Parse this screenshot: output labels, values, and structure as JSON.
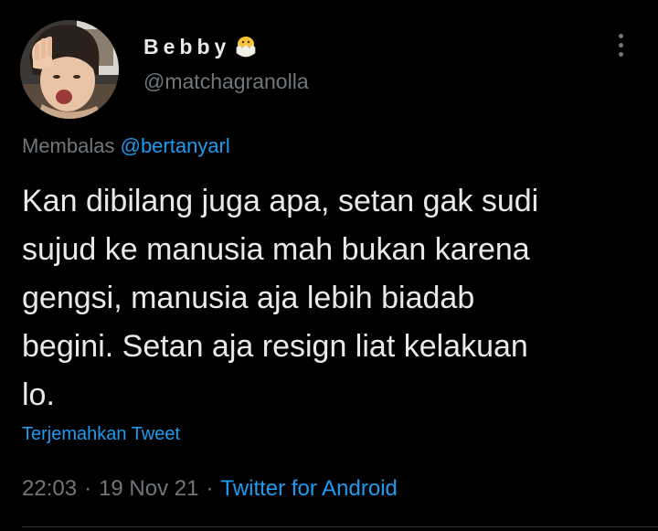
{
  "user": {
    "display_name": "Bebby",
    "name_emoji": "hatching-chick-emoji",
    "handle": "@matchagranolla"
  },
  "reply": {
    "prefix": "Membalas",
    "mention": "@bertanyarl"
  },
  "tweet": {
    "text": "Kan dibilang juga apa, setan gak sudi\nsujud ke manusia mah bukan karena\ngengsi, manusia aja lebih biadab\nbegini. Setan aja resign liat kelakuan\nlo.",
    "translate_label": "Terjemahkan Tweet",
    "time": "22:03",
    "date": "19 Nov 21",
    "source": "Twitter for Android",
    "separator": "·"
  },
  "icons": {
    "more": "more-vertical-icon"
  },
  "colors": {
    "background": "#000000",
    "primary_text": "#e7e9ea",
    "secondary_text": "#71767b",
    "accent": "#1d9bf0"
  }
}
